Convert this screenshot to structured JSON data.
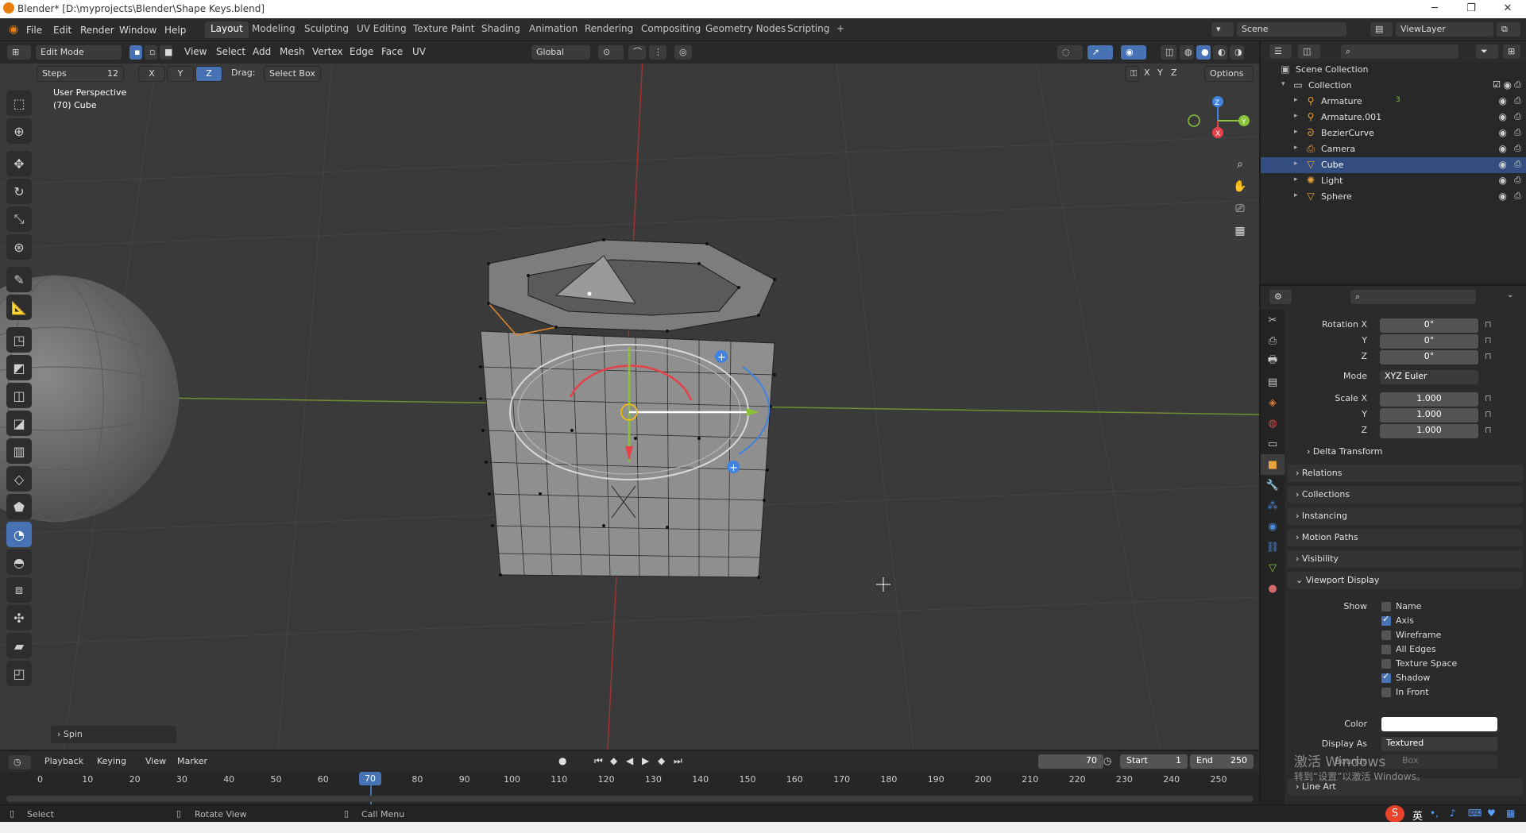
{
  "window": {
    "title": "Blender* [D:\\myprojects\\Blender\\Shape Keys.blend]"
  },
  "menubar": {
    "menus": [
      "File",
      "Edit",
      "Render",
      "Window",
      "Help"
    ],
    "workspaces": [
      "Layout",
      "Modeling",
      "Sculpting",
      "UV Editing",
      "Texture Paint",
      "Shading",
      "Animation",
      "Rendering",
      "Compositing",
      "Geometry Nodes",
      "Scripting",
      "+"
    ],
    "active_workspace": "Layout",
    "scene": "Scene",
    "view_layer": "ViewLayer"
  },
  "viewport": {
    "mode": "Edit Mode",
    "menus": [
      "View",
      "Select",
      "Add",
      "Mesh",
      "Vertex",
      "Edge",
      "Face",
      "UV"
    ],
    "transform_orientation": "Global",
    "tool_settings": {
      "steps_label": "Steps",
      "steps_value": "12",
      "axes": [
        "X",
        "Y",
        "Z"
      ],
      "active_axis": "Z",
      "drag_label": "Drag:",
      "drag_value": "Select Box"
    },
    "options_label": "Options",
    "mirror_axes": [
      "X",
      "Y",
      "Z"
    ],
    "overlay_text": {
      "perspective": "User Perspective",
      "object": "(70) Cube"
    },
    "gizmo_labels": {
      "x": "X",
      "y": "Y",
      "z": "Z"
    },
    "last_operator": "Spin"
  },
  "outliner": {
    "root": "Scene Collection",
    "collection": "Collection",
    "items": [
      {
        "label": "Armature",
        "icon": "armature-icon",
        "color": "#e8a33c",
        "extra": "3"
      },
      {
        "label": "Armature.001",
        "icon": "armature-icon",
        "color": "#e8a33c"
      },
      {
        "label": "BezierCurve",
        "icon": "curve-icon",
        "color": "#e8a33c"
      },
      {
        "label": "Camera",
        "icon": "camera-icon",
        "color": "#e8a33c"
      },
      {
        "label": "Cube",
        "icon": "mesh-icon",
        "color": "#e8a33c",
        "selected": true
      },
      {
        "label": "Light",
        "icon": "light-icon",
        "color": "#e8a33c"
      },
      {
        "label": "Sphere",
        "icon": "mesh-icon",
        "color": "#e8a33c"
      }
    ]
  },
  "properties": {
    "rotation": {
      "label": "Rotation X",
      "x": "0°",
      "y": "0°",
      "z": "0°"
    },
    "axis_labels": {
      "y": "Y",
      "z": "Z"
    },
    "mode": {
      "label": "Mode",
      "value": "XYZ Euler"
    },
    "scale": {
      "label": "Scale X",
      "x": "1.000",
      "y": "1.000",
      "z": "1.000"
    },
    "sections": [
      "Delta Transform",
      "Relations",
      "Collections",
      "Instancing",
      "Motion Paths",
      "Visibility",
      "Viewport Display",
      "Line Art"
    ],
    "viewport_display": {
      "show_label": "Show",
      "checks": [
        {
          "label": "Name",
          "on": false
        },
        {
          "label": "Axis",
          "on": true
        },
        {
          "label": "Wireframe",
          "on": false
        },
        {
          "label": "All Edges",
          "on": false
        },
        {
          "label": "Texture Space",
          "on": false
        },
        {
          "label": "Shadow",
          "on": true
        },
        {
          "label": "In Front",
          "on": false
        }
      ],
      "color_label": "Color",
      "display_as_label": "Display As",
      "display_as_value": "Textured",
      "bounds_label": "Bounds",
      "bounds_value": "Box"
    }
  },
  "timeline": {
    "menus": [
      "Playback",
      "Keying",
      "View",
      "Marker"
    ],
    "current_frame": "70",
    "start_label": "Start",
    "start": "1",
    "end_label": "End",
    "end": "250",
    "ticks": [
      "0",
      "10",
      "20",
      "30",
      "40",
      "50",
      "60",
      "70",
      "80",
      "90",
      "100",
      "110",
      "120",
      "130",
      "140",
      "150",
      "160",
      "170",
      "180",
      "190",
      "200",
      "210",
      "220",
      "230",
      "240",
      "250"
    ]
  },
  "statusbar": {
    "select": "Select",
    "rotate": "Rotate View",
    "menu": "Call Menu"
  },
  "watermark": {
    "line1": "激活 Windows",
    "line2": "转到“设置”以激活 Windows。"
  },
  "ime": {
    "lang": "英"
  },
  "colors": {
    "accent": "#4772b3",
    "selected_row": "#334d80",
    "x_axis": "#e6404a",
    "y_axis": "#8ac23a",
    "z_axis": "#3f82e0",
    "object_orange": "#e8a33c"
  }
}
